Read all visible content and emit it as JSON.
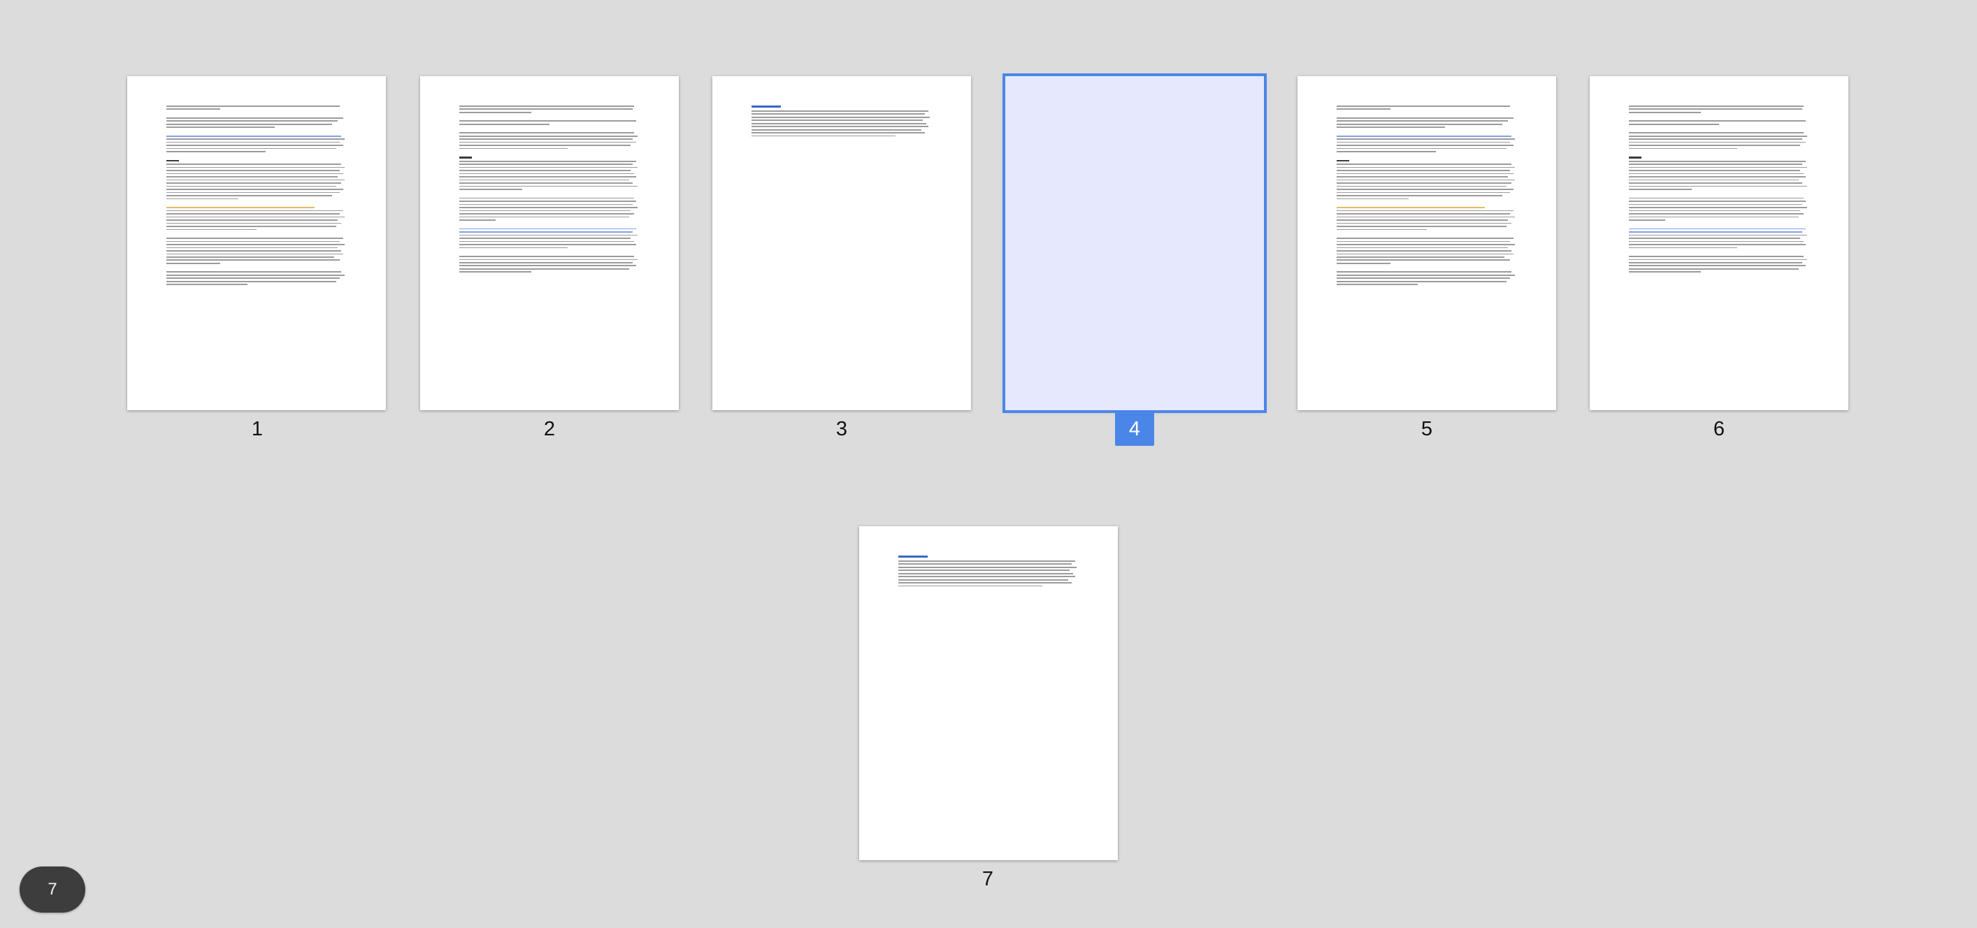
{
  "pages": [
    {
      "number": "1",
      "selected": false
    },
    {
      "number": "2",
      "selected": false
    },
    {
      "number": "3",
      "selected": false
    },
    {
      "number": "4",
      "selected": true
    },
    {
      "number": "5",
      "selected": false
    },
    {
      "number": "6",
      "selected": false
    },
    {
      "number": "7",
      "selected": false
    }
  ],
  "page_count_badge": "7",
  "colors": {
    "background": "#dcdcdc",
    "selection_accent": "#4a86e8",
    "selected_page_fill": "#e6e8fd",
    "badge_background": "#3d3d3d"
  }
}
